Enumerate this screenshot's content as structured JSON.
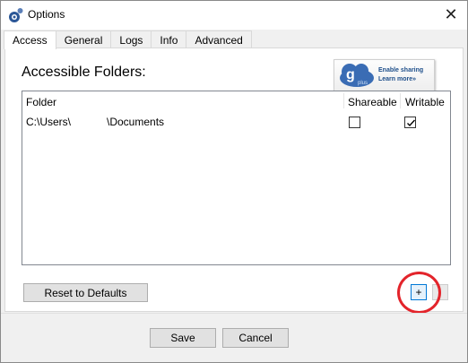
{
  "window": {
    "title": "Options",
    "close_glyph": "✕"
  },
  "tabs": [
    {
      "label": "Access",
      "active": true
    },
    {
      "label": "General",
      "active": false
    },
    {
      "label": "Logs",
      "active": false
    },
    {
      "label": "Info",
      "active": false
    },
    {
      "label": "Advanced",
      "active": false
    }
  ],
  "access": {
    "section_title": "Accessible Folders:",
    "banner": {
      "logo_letter": "g",
      "logo_text": "plus",
      "line1": "Enable sharing",
      "line2": "Learn more»"
    },
    "columns": {
      "folder": "Folder",
      "shareable": "Shareable",
      "writable": "Writable"
    },
    "rows": [
      {
        "path": "C:\\Users\\            \\Documents",
        "shareable": false,
        "writable": true
      }
    ],
    "reset_label": "Reset to Defaults",
    "add_label": "+",
    "remove_label": ""
  },
  "footer": {
    "save_label": "Save",
    "cancel_label": "Cancel"
  },
  "colors": {
    "highlight_ring": "#e3242b",
    "focus_border": "#0078d7"
  }
}
